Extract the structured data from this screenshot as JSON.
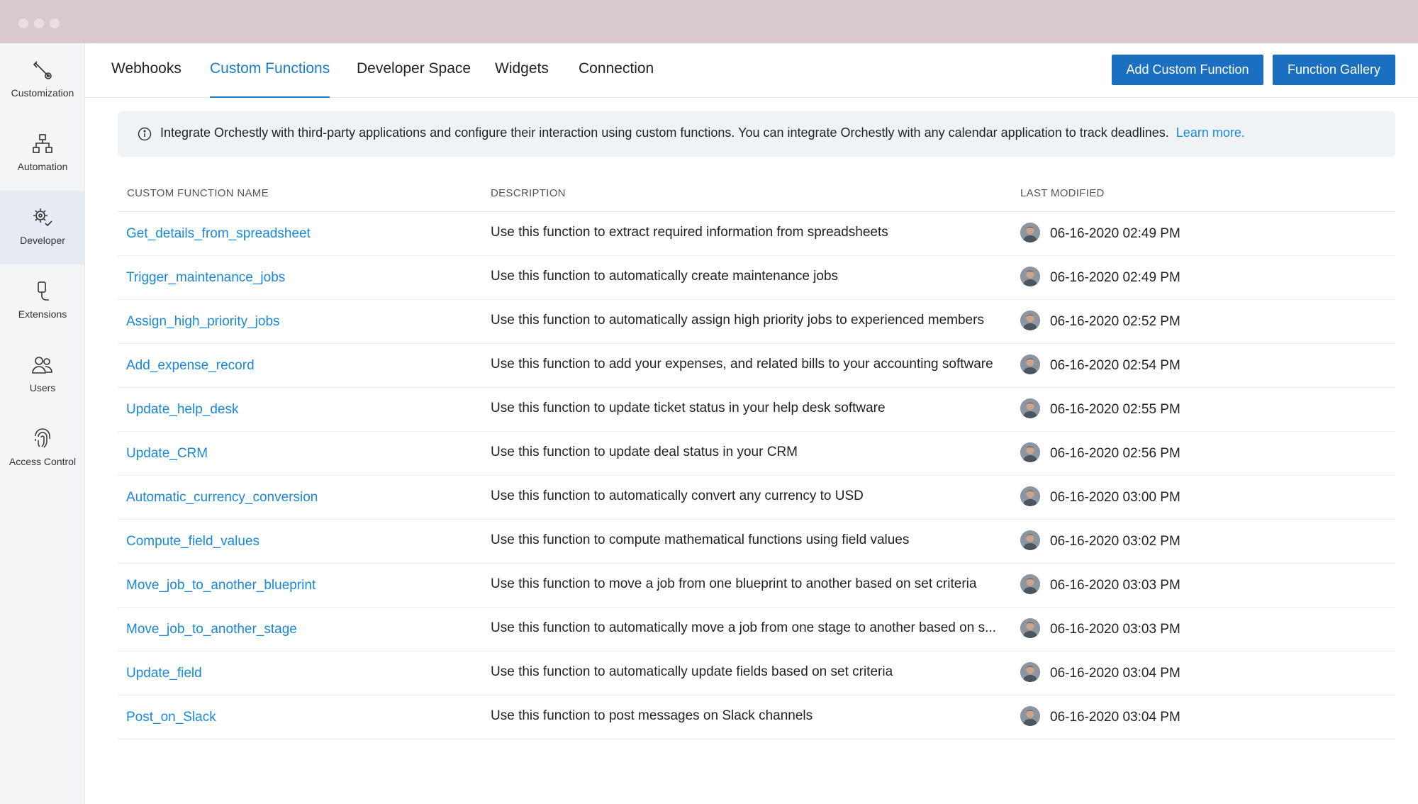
{
  "window": {
    "controls": [
      "close",
      "minimize",
      "maximize"
    ]
  },
  "sidebar": {
    "items": [
      {
        "label": "Customization",
        "icon": "customization-icon",
        "active": false
      },
      {
        "label": "Automation",
        "icon": "automation-icon",
        "active": false
      },
      {
        "label": "Developer",
        "icon": "developer-icon",
        "active": true
      },
      {
        "label": "Extensions",
        "icon": "extensions-icon",
        "active": false
      },
      {
        "label": "Users",
        "icon": "users-icon",
        "active": false
      },
      {
        "label": "Access Control",
        "icon": "fingerprint-icon",
        "active": false
      }
    ]
  },
  "tabs": [
    {
      "label": "Webhooks",
      "active": false
    },
    {
      "label": "Custom Functions",
      "active": true
    },
    {
      "label": "Developer Space",
      "active": false
    },
    {
      "label": "Widgets",
      "active": false
    },
    {
      "label": "Connection",
      "active": false
    }
  ],
  "actions": {
    "add_label": "Add Custom Function",
    "gallery_label": "Function Gallery"
  },
  "banner": {
    "text": "Integrate Orchestly with third-party applications and configure their interaction using custom functions. You can integrate Orchestly with any calendar application to track deadlines.",
    "link": "Learn more."
  },
  "table": {
    "columns": [
      "CUSTOM FUNCTION NAME",
      "DESCRIPTION",
      "LAST MODIFIED"
    ],
    "rows": [
      {
        "name": "Get_details_from_spreadsheet",
        "description": "Use this function to extract required information from spreadsheets",
        "modified": "06-16-2020 02:49 PM"
      },
      {
        "name": "Trigger_maintenance_jobs",
        "description": "Use this function to automatically create maintenance jobs",
        "modified": "06-16-2020 02:49 PM"
      },
      {
        "name": "Assign_high_priority_jobs",
        "description": "Use this function to automatically assign high priority jobs to experienced members",
        "modified": "06-16-2020 02:52 PM"
      },
      {
        "name": "Add_expense_record",
        "description": "Use this function to add your expenses, and related bills to your accounting software",
        "modified": "06-16-2020 02:54 PM"
      },
      {
        "name": "Update_help_desk",
        "description": "Use this function to update ticket status in your help desk software",
        "modified": "06-16-2020 02:55 PM"
      },
      {
        "name": "Update_CRM",
        "description": "Use this function to update deal status in your CRM",
        "modified": "06-16-2020 02:56 PM"
      },
      {
        "name": "Automatic_currency_conversion",
        "description": "Use this function to automatically convert any currency to USD",
        "modified": "06-16-2020 03:00 PM"
      },
      {
        "name": "Compute_field_values",
        "description": "Use this function to compute mathematical functions using field values",
        "modified": "06-16-2020 03:02 PM"
      },
      {
        "name": "Move_job_to_another_blueprint",
        "description": "Use this function to move a job from one blueprint to another based on set criteria",
        "modified": "06-16-2020 03:03 PM"
      },
      {
        "name": "Move_job_to_another_stage",
        "description": "Use this function to automatically move a job from one stage to another based on s...",
        "modified": "06-16-2020 03:03 PM"
      },
      {
        "name": "Update_field",
        "description": "Use this function to automatically update fields based on set criteria",
        "modified": "06-16-2020 03:04 PM"
      },
      {
        "name": "Post_on_Slack",
        "description": "Use this function to post messages on Slack channels",
        "modified": "06-16-2020 03:04 PM"
      }
    ]
  },
  "colors": {
    "accent": "#1a88d8",
    "button": "#1a6fc0",
    "titlebar": "#d7c9cc",
    "sidebar": "#f4f5f7",
    "banner": "#eff3f5"
  }
}
